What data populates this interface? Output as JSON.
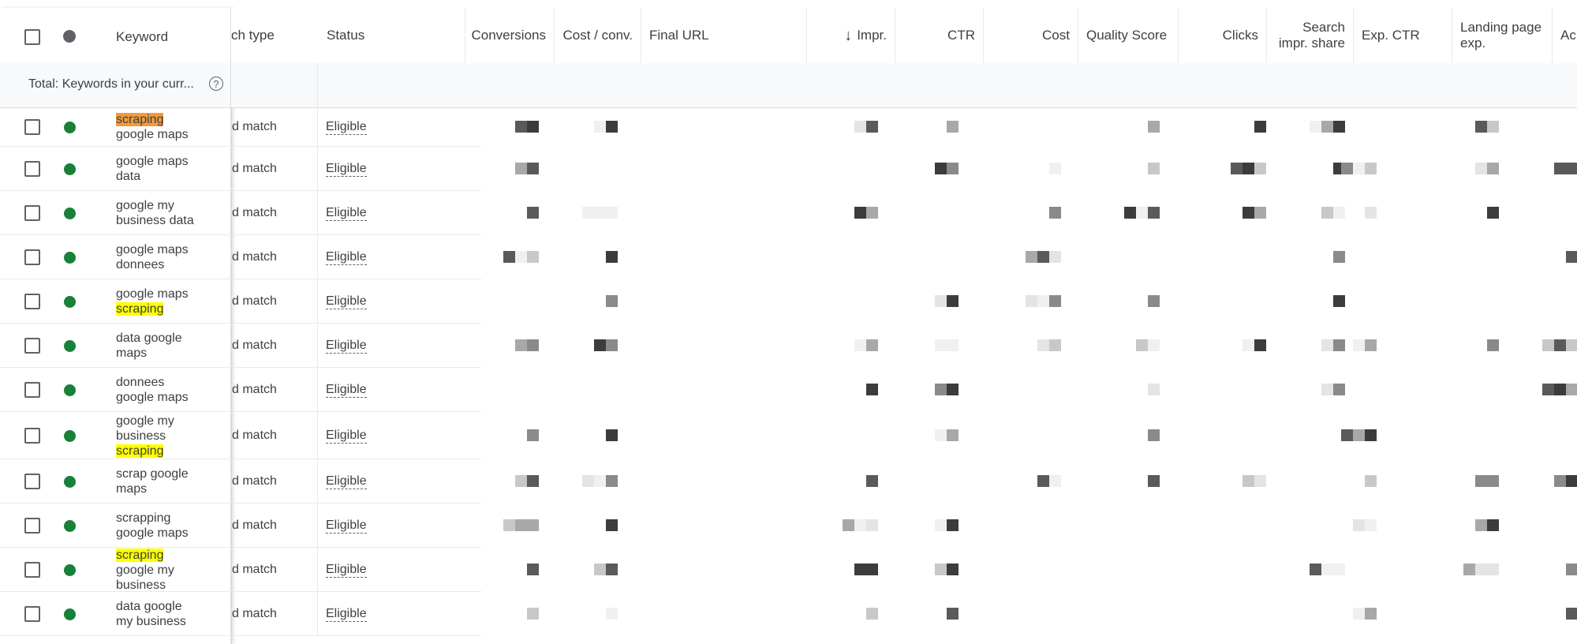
{
  "header": {
    "keyword": "Keyword",
    "match_type": "ch type",
    "status": "Status",
    "conversions": "Conversions",
    "cost_conv": "Cost / conv.",
    "final_url": "Final URL",
    "impr_arrow": "↓",
    "impr": "Impr.",
    "ctr": "CTR",
    "cost": "Cost",
    "quality_score": "Quality Score",
    "clicks": "Clicks",
    "search_impr_share": "Search impr. share",
    "exp_ctr": "Exp. CTR",
    "landing_page_exp": "Landing page exp.",
    "ad_relevance": "Ac"
  },
  "total": {
    "label": "Total: Keywords in your curr...",
    "help_icon": "?"
  },
  "rows": [
    {
      "kw": [
        "",
        "google maps"
      ],
      "hl_word": "scraping",
      "hl_pos": "first",
      "hl_color": "orange",
      "match": "d match",
      "status": "Eligible"
    },
    {
      "kw": [
        "google maps",
        "data"
      ],
      "match": "d match",
      "status": "Eligible"
    },
    {
      "kw": [
        "google my",
        "business data"
      ],
      "match": "d match",
      "status": "Eligible"
    },
    {
      "kw": [
        "google maps",
        "donnees"
      ],
      "match": "d match",
      "status": "Eligible"
    },
    {
      "kw": [
        "google maps",
        ""
      ],
      "hl_word": "scraping",
      "hl_pos": "last",
      "hl_color": "yellow",
      "match": "d match",
      "status": "Eligible"
    },
    {
      "kw": [
        "data google",
        "maps"
      ],
      "match": "d match",
      "status": "Eligible"
    },
    {
      "kw": [
        "donnees",
        "google maps"
      ],
      "match": "d match",
      "status": "Eligible"
    },
    {
      "kw": [
        "google my",
        "business",
        ""
      ],
      "hl_word": "scraping",
      "hl_pos": "last",
      "hl_color": "yellow",
      "match": "d match",
      "status": "Eligible"
    },
    {
      "kw": [
        "scrap google",
        "maps"
      ],
      "match": "d match",
      "status": "Eligible"
    },
    {
      "kw": [
        "scrapping",
        "google maps"
      ],
      "match": "d match",
      "status": "Eligible"
    },
    {
      "kw": [
        "",
        "google my",
        "business"
      ],
      "hl_word": "scraping",
      "hl_pos": "first",
      "hl_color": "yellow",
      "match": "d match",
      "status": "Eligible"
    },
    {
      "kw": [
        "data google",
        "my business"
      ],
      "match": "d match",
      "status": "Eligible"
    }
  ],
  "colors": {
    "status_dot": "#188038",
    "highlight_yellow": "#ffff00",
    "highlight_orange": "#f29a3c"
  }
}
